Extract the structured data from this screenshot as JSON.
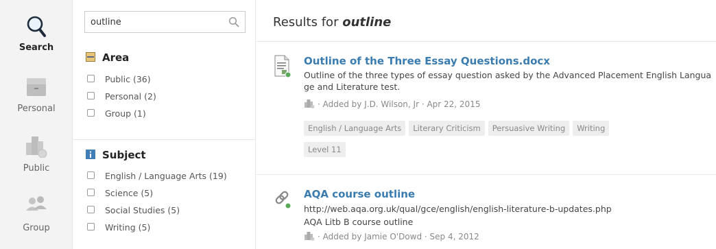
{
  "rail": {
    "items": [
      {
        "label": "Search",
        "icon": "search-icon"
      },
      {
        "label": "Personal",
        "icon": "folder-icon"
      },
      {
        "label": "Public",
        "icon": "building-icon"
      },
      {
        "label": "Group",
        "icon": "people-icon"
      }
    ]
  },
  "search": {
    "value": "outline",
    "placeholder": ""
  },
  "facets": {
    "area": {
      "title": "Area",
      "options": [
        "Public (36)",
        "Personal (2)",
        "Group (1)"
      ]
    },
    "subject": {
      "title": "Subject",
      "options": [
        "English / Language Arts (19)",
        "Science (5)",
        "Social Studies (5)",
        "Writing (5)"
      ]
    }
  },
  "main": {
    "title_prefix": "Results for ",
    "title_query": "outline"
  },
  "results": [
    {
      "title": "Outline of the Three Essay Questions.docx",
      "description": "Outline of the three types of essay question asked by the Advanced Placement English Language and Literature test.",
      "meta": "· Added by J.D. Wilson, Jr · Apr 22, 2015",
      "tags": [
        "English / Language Arts",
        "Literary Criticism",
        "Persuasive Writing",
        "Writing",
        "Level 11"
      ]
    },
    {
      "title": "AQA course outline",
      "url": "http://web.aqa.org.uk/qual/gce/english/english-literature-b-updates.php",
      "description": "AQA Litb B course outline",
      "meta": "· Added by Jamie O'Dowd · Sep 4, 2012"
    }
  ],
  "colors": {
    "link": "#3a7cb0",
    "status_dot": "#5aaa5a"
  }
}
